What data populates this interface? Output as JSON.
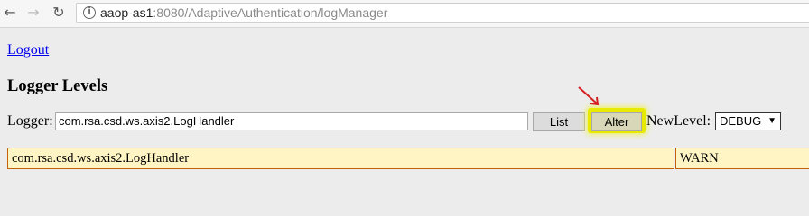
{
  "browser": {
    "url_host": "aaop-as1",
    "url_rest": ":8080/AdaptiveAuthentication/logManager"
  },
  "page": {
    "logout_link": "Logout",
    "heading": "Logger Levels",
    "logger_label": "Logger:",
    "logger_value": "com.rsa.csd.ws.axis2.LogHandler",
    "list_button": "List",
    "alter_button": "Alter",
    "newlevel_label": "NewLevel:",
    "newlevel_selected": "DEBUG"
  },
  "loggers_table": [
    {
      "name": "com.rsa.csd.ws.axis2.LogHandler",
      "level": "WARN"
    }
  ],
  "colors": {
    "highlight": "#e7ea00",
    "annotation_arrow": "#d42020",
    "row_background": "#fff5c4",
    "row_border": "#c3600a",
    "link": "#0000ee"
  }
}
